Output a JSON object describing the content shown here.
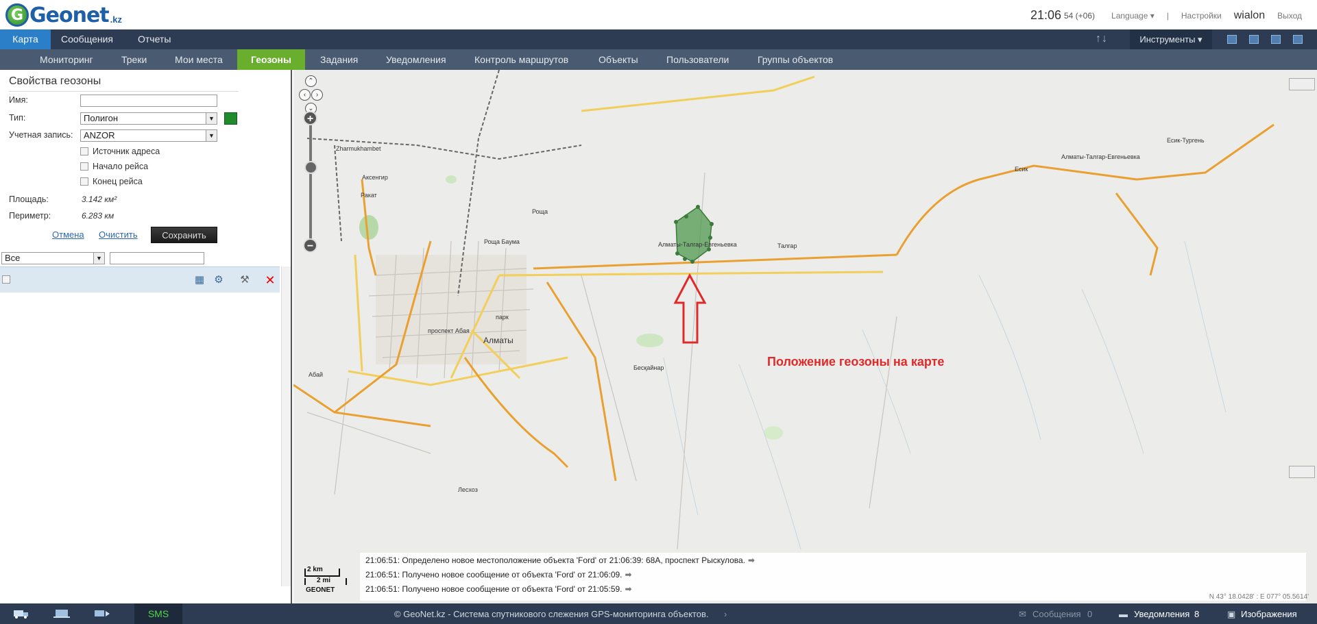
{
  "app": {
    "logo_word": "Geonet",
    "logo_tld": ".kz",
    "clock_time": "21:06",
    "clock_seconds": "54 (+06)",
    "language": "Language ▾",
    "settings": "Настройки",
    "brand": "wialon",
    "logout": "Выход"
  },
  "main_tabs": [
    {
      "label": "Карта",
      "active": true
    },
    {
      "label": "Сообщения",
      "active": false
    },
    {
      "label": "Отчеты",
      "active": false
    }
  ],
  "tools_label": "Инструменты ▾",
  "sort_label": "↑↓",
  "sub_tabs": [
    {
      "label": "Мониторинг"
    },
    {
      "label": "Треки"
    },
    {
      "label": "Мои места"
    },
    {
      "label": "Геозоны",
      "active": true
    },
    {
      "label": "Задания"
    },
    {
      "label": "Уведомления"
    },
    {
      "label": "Контроль маршрутов"
    },
    {
      "label": "Объекты"
    },
    {
      "label": "Пользователи"
    },
    {
      "label": "Группы объектов"
    }
  ],
  "geofence": {
    "title": "Свойства геозоны",
    "name_label": "Имя:",
    "name_value": "",
    "type_label": "Тип:",
    "type_value": "Полигон",
    "color": "#1f8a2e",
    "account_label": "Учетная запись:",
    "account_value": "ANZOR",
    "checkboxes": [
      {
        "label": "Источник адреса",
        "checked": false
      },
      {
        "label": "Начало рейса",
        "checked": false
      },
      {
        "label": "Конец рейса",
        "checked": false
      }
    ],
    "area_label": "Площадь:",
    "area_value": "3.142 км²",
    "perimeter_label": "Периметр:",
    "perimeter_value": "6.283 км",
    "cancel": "Отмена",
    "clear": "Очистить",
    "save": "Сохранить"
  },
  "filter": {
    "select_value": "Все",
    "search_value": ""
  },
  "list_icons": [
    "map-settings-icon",
    "car-settings-icon",
    "wrench-icon",
    "delete-icon"
  ],
  "map": {
    "annotation": "Положение геозоны на карте",
    "places": [
      {
        "name": "Zharmukhambet"
      },
      {
        "name": "Аксенгир"
      },
      {
        "name": "Ракат"
      },
      {
        "name": "Роща"
      },
      {
        "name": "Роща Баума"
      },
      {
        "name": "Алматы"
      },
      {
        "name": "парк"
      },
      {
        "name": "Талгар"
      },
      {
        "name": "Есик"
      },
      {
        "name": "Бесқайнар"
      },
      {
        "name": "Абай"
      },
      {
        "name": "Лесхоз"
      },
      {
        "name": "Алматы-Талгар-Евгеньевка"
      },
      {
        "name": "Алматы-Талгар-Евгеньевка"
      },
      {
        "name": "Есик-Тургень"
      },
      {
        "name": "проспект Абая"
      }
    ],
    "scale_km": "2 km",
    "scale_mi": "2 mi",
    "scale_brand": "GEONET",
    "coords": "N 43° 18.0428' : E 077° 05.5614'"
  },
  "log": [
    "21:06:51: Определено новое местоположение объекта 'Ford' от 21:06:39: 68А, проспект Рыскулова.",
    "21:06:51: Получено новое сообщение от объекта 'Ford' от 21:06:09.",
    "21:06:51: Получено новое сообщение от объекта 'Ford' от 21:05:59."
  ],
  "bottom": {
    "sms": "SMS",
    "copyright": "© GeoNet.kz - Система спутникового слежения GPS-мониторинга объектов.",
    "messages_label": "Сообщения",
    "messages_count": "0",
    "notifications_label": "Уведомления",
    "notifications_count": "8",
    "images_label": "Изображения"
  },
  "colors": {
    "nav_bg": "#2d3c52",
    "active_tab": "#2a7fc8",
    "active_subtab": "#6aae2e",
    "annotation": "#e02a2a"
  }
}
